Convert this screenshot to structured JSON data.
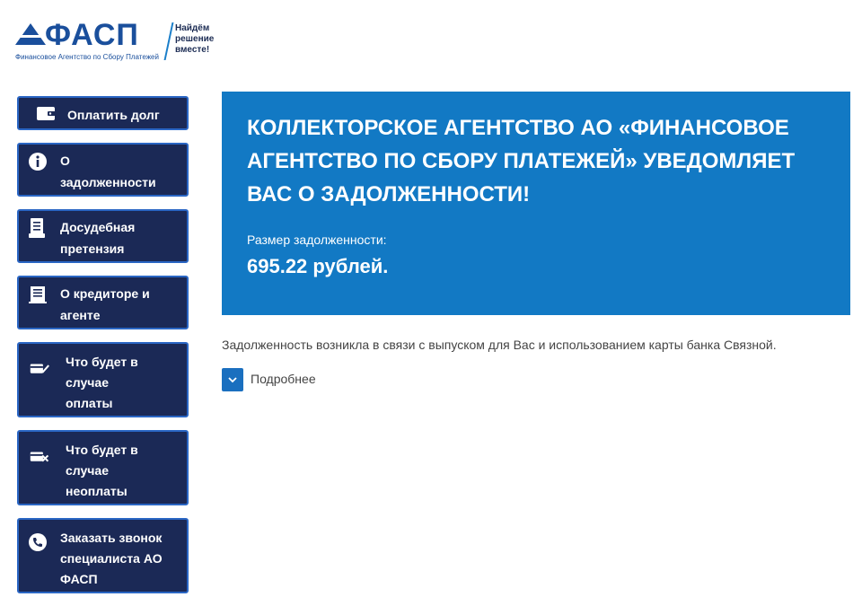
{
  "header": {
    "logo_text": "ФАСП",
    "logo_subtitle": "Финансовое Агентство по Сбору Платежей",
    "slogan_line1": "Найдём",
    "slogan_line2": "решение",
    "slogan_line3": "вместе!"
  },
  "sidebar": {
    "items": [
      {
        "icon": "wallet-icon",
        "lines": [
          "Оплатить долг"
        ]
      },
      {
        "icon": "info-icon",
        "lines": [
          "О",
          "задолженности"
        ]
      },
      {
        "icon": "document-icon",
        "lines": [
          "Досудебная",
          "претензия"
        ]
      },
      {
        "icon": "building-icon",
        "lines": [
          "О кредиторе и",
          "агенте"
        ]
      },
      {
        "icon": "card-check-icon",
        "lines": [
          "Что будет в",
          "случае",
          "оплаты"
        ]
      },
      {
        "icon": "card-cross-icon",
        "lines": [
          "Что будет в",
          "случае",
          "неоплаты"
        ]
      },
      {
        "icon": "phone-icon",
        "lines": [
          "Заказать звонок",
          "специалиста АО",
          "ФАСП"
        ]
      }
    ]
  },
  "main": {
    "banner_title": "КОЛЛЕКТОРСКОЕ АГЕНТСТВО АО «ФИНАНСОВОЕ АГЕНТСТВО ПО СБОРУ ПЛАТЕЖЕЙ» УВЕДОМЛЯЕТ ВАС О ЗАДОЛЖЕННОСТИ!",
    "debt_label": "Размер задолженности:",
    "debt_amount": "695.22 рублей.",
    "reason_text": "Задолженность возникла в связи с выпуском для Вас и использованием карты банка Связной.",
    "more_label": "Подробнее"
  },
  "colors": {
    "brand_dark": "#1b2956",
    "brand_blue": "#1279c4",
    "button_border": "#2a66c4"
  }
}
